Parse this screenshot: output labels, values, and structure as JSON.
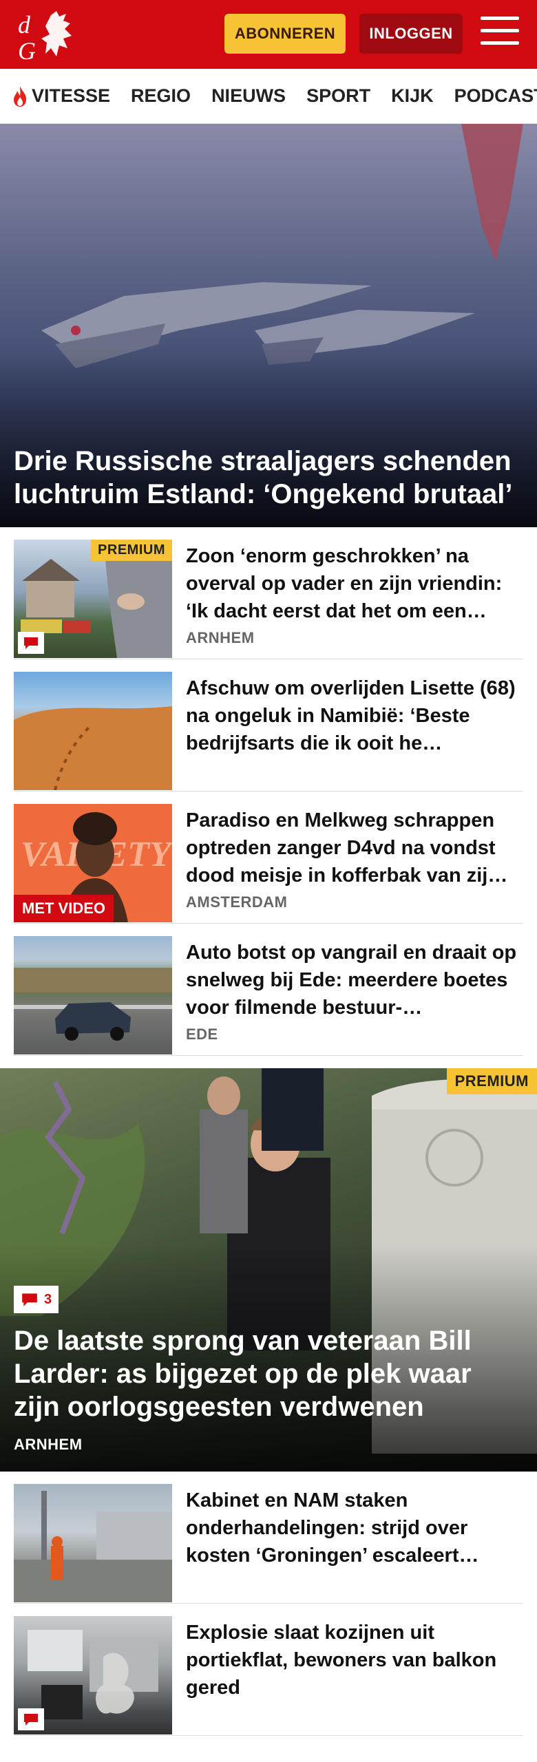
{
  "header": {
    "subscribe_label": "ABONNEREN",
    "login_label": "INLOGGEN",
    "brand_color": "#d10a11"
  },
  "nav": {
    "items": [
      {
        "label": "VITESSE",
        "icon": "flame-icon"
      },
      {
        "label": "REGIO"
      },
      {
        "label": "NIEUWS"
      },
      {
        "label": "SPORT"
      },
      {
        "label": "KIJK"
      },
      {
        "label": "PODCAST"
      }
    ]
  },
  "hero": {
    "title": "Drie Russische straaljagers schenden luchtruim Estland: ‘Ongekend brutaal’"
  },
  "articles": [
    {
      "title": "Zoon ‘enorm geschrokken’ na overval op vader en zijn vriendin: ‘Ik dacht eerst dat het om een…",
      "tag": "ARNHEM",
      "premium": "PREMIUM",
      "comments": "comment-icon"
    },
    {
      "title": "Afschuw om overlijden Lisette (68) na ongeluk in Namibië: ‘Beste bedrijfsarts die ik ooit he…"
    },
    {
      "title": "Paradiso en Melkweg schrappen optreden zanger D4vd na vondst dood meisje in kofferbak van zij…",
      "tag": "AMSTERDAM",
      "video": "MET VIDEO"
    },
    {
      "title": "Auto botst op vangrail en draait op snelweg bij Ede: meerdere boetes voor filmende bestuur-…",
      "tag": "EDE"
    }
  ],
  "feature": {
    "premium": "PREMIUM",
    "comment_count": "3",
    "title": "De laatste sprong van veteraan Bill Larder: as bijgezet op de plek waar zijn oorlogsgeesten verdwenen",
    "tag": "ARNHEM"
  },
  "articles2": [
    {
      "title": "Kabinet en NAM staken onderhandelingen: strijd over kosten ‘Groningen’ escaleert…"
    },
    {
      "title": "Explosie slaat kozijnen uit portiekflat, bewoners van balkon gered",
      "comments": "comment-icon"
    }
  ]
}
